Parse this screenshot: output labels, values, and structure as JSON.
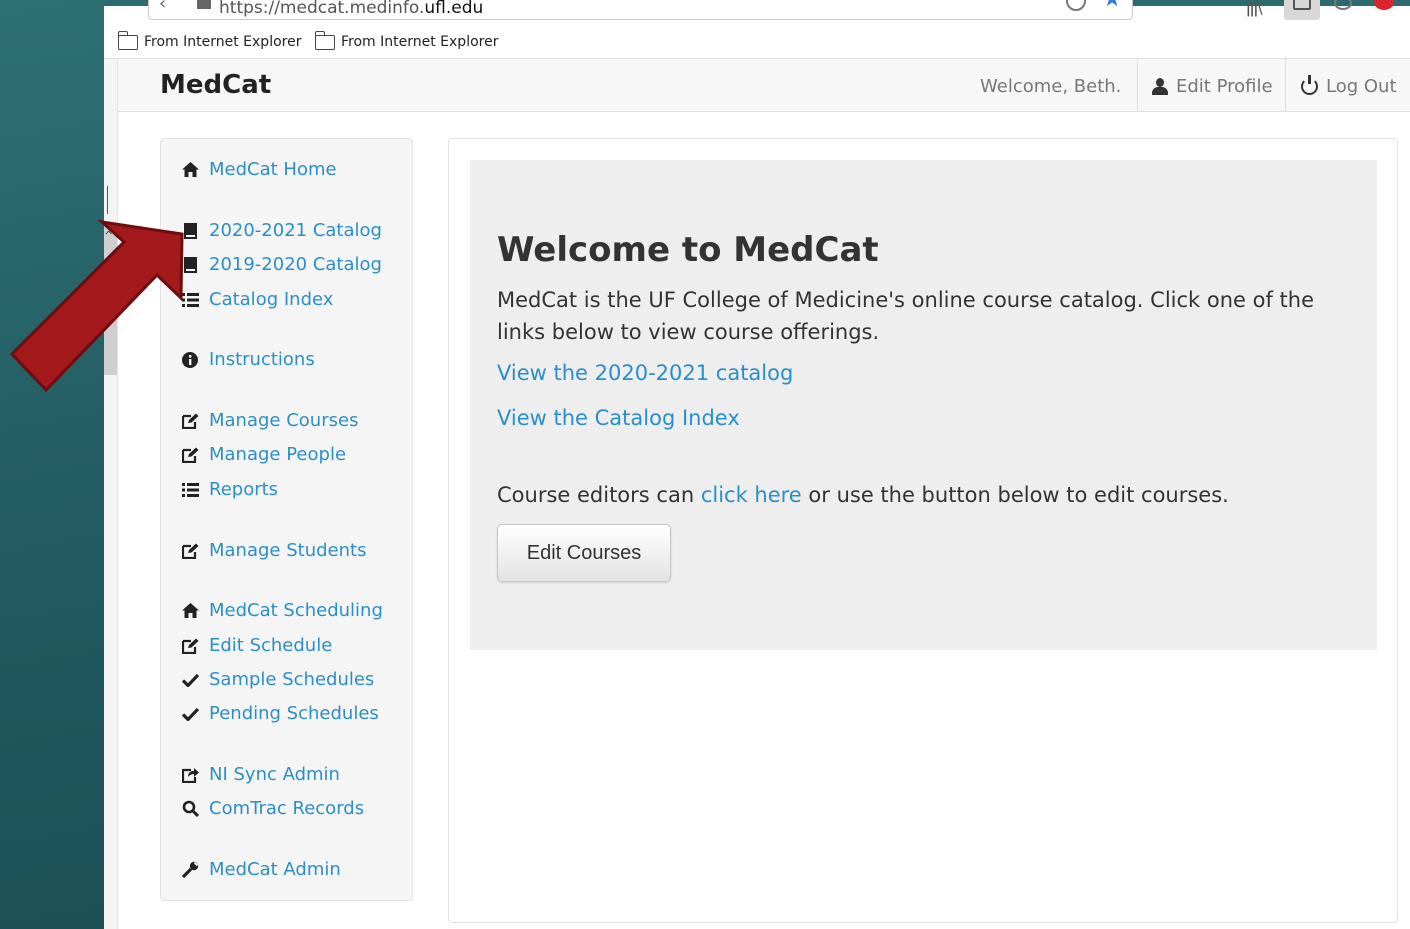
{
  "browser": {
    "url_prefix": "https://medcat.medinfo.",
    "url_domain": "ufl.edu",
    "bookmarks": [
      "From Internet Explorer",
      "From Internet Explorer"
    ]
  },
  "navbar": {
    "brand": "MedCat",
    "welcome": "Welcome, Beth.",
    "edit_profile": "Edit Profile",
    "log_out": "Log Out"
  },
  "sidebar": {
    "items": [
      {
        "label": "MedCat Home",
        "icon": "home-icon"
      },
      {
        "label": "2020-2021 Catalog",
        "icon": "book-icon"
      },
      {
        "label": "2019-2020 Catalog",
        "icon": "book-icon"
      },
      {
        "label": "Catalog Index",
        "icon": "list-icon"
      },
      {
        "label": "Instructions",
        "icon": "info-icon"
      },
      {
        "label": "Manage Courses",
        "icon": "edit-icon"
      },
      {
        "label": "Manage People",
        "icon": "edit-icon"
      },
      {
        "label": "Reports",
        "icon": "list-icon"
      },
      {
        "label": "Manage Students",
        "icon": "edit-icon"
      },
      {
        "label": "MedCat Scheduling",
        "icon": "home-icon"
      },
      {
        "label": "Edit Schedule",
        "icon": "edit-icon"
      },
      {
        "label": "Sample Schedules",
        "icon": "check-icon"
      },
      {
        "label": "Pending Schedules",
        "icon": "check-icon"
      },
      {
        "label": "NI Sync Admin",
        "icon": "share-icon"
      },
      {
        "label": "ComTrac Records",
        "icon": "search-icon"
      },
      {
        "label": "MedCat Admin",
        "icon": "wrench-icon"
      }
    ]
  },
  "main": {
    "heading": "Welcome to MedCat",
    "intro": "MedCat is the UF College of Medicine's online course catalog. Click one of the links below to view course offerings.",
    "link_catalog": "View the 2020-2021 catalog",
    "link_index": "View the Catalog Index",
    "editors_prefix": "Course editors can ",
    "editors_link": "click here",
    "editors_suffix": " or use the button below to edit courses.",
    "edit_button": "Edit Courses"
  },
  "colors": {
    "link": "#2a8fc9",
    "arrow": "#a3191c",
    "slide_background": "#215a61"
  }
}
